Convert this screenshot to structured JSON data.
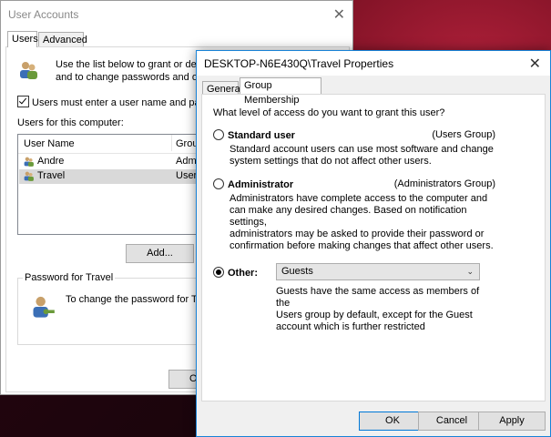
{
  "back_window": {
    "title": "User Accounts",
    "tabs": [
      {
        "label": "Users",
        "active": true
      },
      {
        "label": "Advanced",
        "active": false
      }
    ],
    "description_lines": [
      "Use the list below to grant or deny",
      "and to change passwords and othe"
    ],
    "checkbox_label": "Users must enter a user name and passwo",
    "users_label": "Users for this computer:",
    "list_columns": [
      "User Name",
      "Group"
    ],
    "list_rows": [
      {
        "name": "Andre",
        "group": "Adm",
        "selected": false
      },
      {
        "name": "Travel",
        "group": "Users",
        "selected": true
      }
    ],
    "add_button": "Add...",
    "password_group_title": "Password for Travel",
    "password_text": "To change the password for Trav",
    "ok_button_partial": "O"
  },
  "dialog": {
    "title": "DESKTOP-N6E430Q\\Travel Properties",
    "tabs": [
      {
        "label": "General",
        "active": false
      },
      {
        "label": "Group Membership",
        "active": true
      }
    ],
    "question": "What level of access do you want to grant this user?",
    "options": [
      {
        "label": "Standard user",
        "group": "(Users Group)",
        "checked": false,
        "desc_lines": [
          "Standard account users can use most software and change",
          "system settings that do not affect other users."
        ]
      },
      {
        "label": "Administrator",
        "group": "(Administrators Group)",
        "checked": false,
        "desc_lines": [
          "Administrators have complete access to the computer and",
          "can make any desired changes. Based on notification settings,",
          "administrators may be asked to provide their password or",
          "confirmation before making changes that affect other users."
        ]
      },
      {
        "label": "Other:",
        "checked": true,
        "desc_lines": [
          "Guests have the same access as members of the",
          "Users group by default, except for the Guest",
          "account which is further restricted"
        ]
      }
    ],
    "other_select_value": "Guests",
    "buttons": {
      "ok": "OK",
      "cancel": "Cancel",
      "apply": "Apply"
    }
  },
  "colors": {
    "accent": "#0078d7",
    "dialog_border": "#1883d7"
  }
}
